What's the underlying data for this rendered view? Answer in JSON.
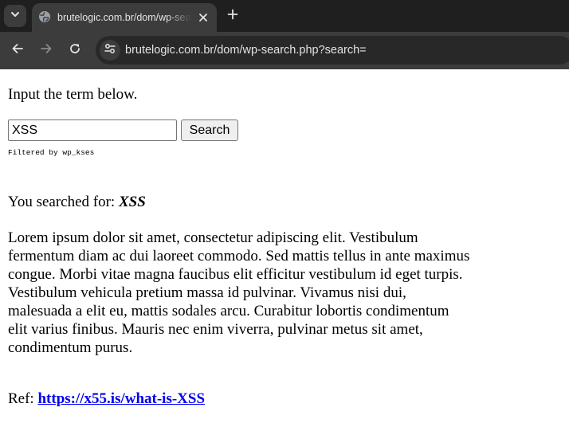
{
  "browser": {
    "tab": {
      "title": "brutelogic.com.br/dom/wp-search.php?search=",
      "favicon": "globe-icon"
    },
    "url": "brutelogic.com.br/dom/wp-search.php?search=",
    "icons": {
      "tab_menu": "chevron-down-icon",
      "tab_close": "close-icon",
      "new_tab": "plus-icon",
      "back": "arrow-left-icon",
      "forward": "arrow-right-icon",
      "reload": "reload-icon",
      "site_info": "tune-icon"
    },
    "colors": {
      "tabbar_bg": "#1f1f1f",
      "toolbar_bg": "#3c3c3c",
      "omnibox_bg": "#282828",
      "text": "#e3e3e3"
    }
  },
  "page": {
    "intro": "Input the term below.",
    "search": {
      "value": "XSS",
      "button_label": "Search"
    },
    "filter_note": "Filtered by wp_kses",
    "searched_prefix": "You searched for: ",
    "searched_term": "XSS",
    "lorem": "Lorem ipsum dolor sit amet, consectetur adipiscing elit. Vestibulum fermentum diam ac dui laoreet commodo. Sed mattis tellus in ante maximus congue. Morbi vitae magna faucibus elit efficitur vestibulum id eget turpis. Vestibulum vehicula pretium massa id pulvinar. Vivamus nisi dui, malesuada a elit eu, mattis sodales arcu. Curabitur lobortis condimentum elit varius finibus. Mauris nec enim viverra, pulvinar metus sit amet, condimentum purus.",
    "ref_label": "Ref: ",
    "ref_link": "https://x55.is/what-is-XSS",
    "colors": {
      "link": "#0000ee"
    }
  }
}
